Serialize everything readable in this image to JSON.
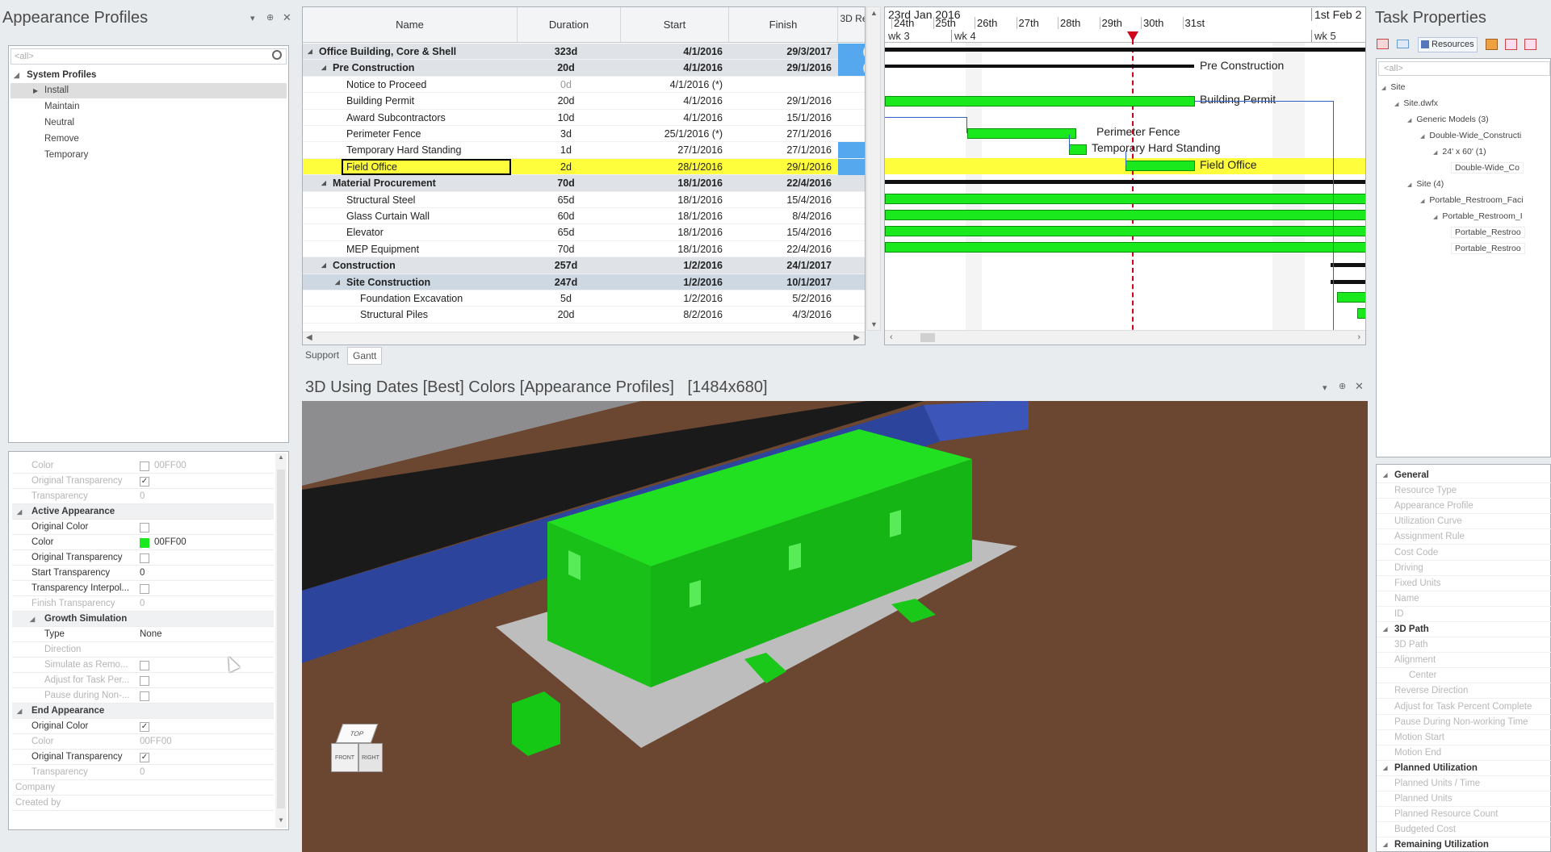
{
  "left_panel": {
    "title": "Appearance Profiles",
    "filter_placeholder": "<all>",
    "tree_root": "System Profiles",
    "tree_items": [
      "Install",
      "Maintain",
      "Neutral",
      "Remove",
      "Temporary"
    ],
    "properties": [
      {
        "label": "Color",
        "value": "00FF00",
        "dim": true,
        "check": "box"
      },
      {
        "label": "Original Transparency",
        "value": "",
        "dim": true,
        "check": "checked"
      },
      {
        "label": "Transparency",
        "value": "0",
        "dim": true
      },
      {
        "label": "Active Appearance",
        "section": true
      },
      {
        "label": "Original Color",
        "value": "",
        "check": "box"
      },
      {
        "label": "Color",
        "value": "00FF00",
        "swatch": "#19e91d"
      },
      {
        "label": "Original Transparency",
        "value": "",
        "check": "box"
      },
      {
        "label": "Start Transparency",
        "value": "0"
      },
      {
        "label": "Transparency Interpol...",
        "value": "",
        "check": "box"
      },
      {
        "label": "Finish Transparency",
        "value": "0",
        "dim": true
      },
      {
        "label": "Growth Simulation",
        "section": true,
        "sub": true
      },
      {
        "label": "Type",
        "value": "None",
        "sub": true
      },
      {
        "label": "Direction",
        "value": "",
        "dim": true,
        "sub": true
      },
      {
        "label": "Simulate as Remo...",
        "value": "",
        "dim": true,
        "sub": true,
        "check": "box"
      },
      {
        "label": "Adjust for Task Per...",
        "value": "",
        "dim": true,
        "sub": true,
        "check": "box"
      },
      {
        "label": "Pause during Non-...",
        "value": "",
        "dim": true,
        "sub": true,
        "check": "box"
      },
      {
        "label": "End Appearance",
        "section": true
      },
      {
        "label": "Original Color",
        "value": "",
        "check": "checked"
      },
      {
        "label": "Color",
        "value": "00FF00",
        "dim": true
      },
      {
        "label": "Original Transparency",
        "value": "",
        "check": "checked"
      },
      {
        "label": "Transparency",
        "value": "0",
        "dim": true
      },
      {
        "label": "Company",
        "value": "",
        "dim": true,
        "top": true
      },
      {
        "label": "Created by",
        "value": "",
        "dim": true,
        "top": true
      }
    ]
  },
  "grid": {
    "columns": [
      "Name",
      "Duration",
      "Start",
      "Finish",
      "3D Re..."
    ],
    "rows": [
      {
        "name": "Office Building, Core & Shell",
        "level": 0,
        "type": "sum",
        "duration": "323d",
        "start": "4/1/2016",
        "finish": "29/3/2017",
        "res": "(4)"
      },
      {
        "name": "Pre Construction",
        "level": 1,
        "type": "sum",
        "duration": "20d",
        "start": "4/1/2016",
        "finish": "29/1/2016",
        "res": "(4)"
      },
      {
        "name": "Notice to Proceed",
        "level": 2,
        "type": "task",
        "duration": "0d",
        "start": "4/1/2016 (*)",
        "finish": "",
        "res": ""
      },
      {
        "name": "Building Permit",
        "level": 2,
        "type": "task",
        "duration": "20d",
        "start": "4/1/2016",
        "finish": "29/1/2016",
        "res": ""
      },
      {
        "name": "Award Subcontractors",
        "level": 2,
        "type": "task",
        "duration": "10d",
        "start": "4/1/2016",
        "finish": "15/1/2016",
        "res": ""
      },
      {
        "name": "Perimeter Fence",
        "level": 2,
        "type": "task",
        "duration": "3d",
        "start": "25/1/2016 (*)",
        "finish": "27/1/2016",
        "res": ""
      },
      {
        "name": "Temporary Hard Standing",
        "level": 2,
        "type": "task",
        "duration": "1d",
        "start": "27/1/2016",
        "finish": "27/1/2016",
        "res": "1"
      },
      {
        "name": "Field Office",
        "level": 2,
        "type": "sel",
        "duration": "2d",
        "start": "28/1/2016",
        "finish": "29/1/2016",
        "res": "3"
      },
      {
        "name": "Material Procurement",
        "level": 1,
        "type": "sum",
        "duration": "70d",
        "start": "18/1/2016",
        "finish": "22/4/2016",
        "res": ""
      },
      {
        "name": "Structural Steel",
        "level": 2,
        "type": "task",
        "duration": "65d",
        "start": "18/1/2016",
        "finish": "15/4/2016",
        "res": ""
      },
      {
        "name": "Glass Curtain Wall",
        "level": 2,
        "type": "task",
        "duration": "60d",
        "start": "18/1/2016",
        "finish": "8/4/2016",
        "res": ""
      },
      {
        "name": "Elevator",
        "level": 2,
        "type": "task",
        "duration": "65d",
        "start": "18/1/2016",
        "finish": "15/4/2016",
        "res": ""
      },
      {
        "name": "MEP Equipment",
        "level": 2,
        "type": "task",
        "duration": "70d",
        "start": "18/1/2016",
        "finish": "22/4/2016",
        "res": ""
      },
      {
        "name": "Construction",
        "level": 1,
        "type": "sum",
        "duration": "257d",
        "start": "1/2/2016",
        "finish": "24/1/2017",
        "res": ""
      },
      {
        "name": "Site Construction",
        "level": 2,
        "type": "sum2",
        "duration": "247d",
        "start": "1/2/2016",
        "finish": "10/1/2017",
        "res": ""
      },
      {
        "name": "Foundation Excavation",
        "level": 3,
        "type": "task",
        "duration": "5d",
        "start": "1/2/2016",
        "finish": "5/2/2016",
        "res": ""
      },
      {
        "name": "Structural Piles",
        "level": 3,
        "type": "task",
        "duration": "20d",
        "start": "8/2/2016",
        "finish": "4/3/2016",
        "res": ""
      }
    ],
    "tabs": [
      "Support",
      "Gantt"
    ]
  },
  "gantt": {
    "date_top": [
      "23rd Jan 2016",
      "1st Feb 2"
    ],
    "days": [
      "24th",
      "25th",
      "26th",
      "27th",
      "28th",
      "29th",
      "30th",
      "31st"
    ],
    "weeks": [
      "wk 3",
      "wk 4",
      "wk 5"
    ],
    "labels": [
      "Pre Construction",
      "Building Permit",
      "Perimeter Fence",
      "Temporary Hard Standing",
      "Field Office"
    ]
  },
  "viewport": {
    "title": "3D Using Dates [Best] Colors [Appearance Profiles]   [1484x680]",
    "cube_faces": [
      "TOP",
      "FRONT",
      "RIGHT"
    ]
  },
  "right_panel": {
    "title": "Task Properties",
    "toolbar_resources": "Resources",
    "filter_placeholder": "<all>",
    "tree": [
      {
        "label": "Site",
        "indent": 0
      },
      {
        "label": "Site.dwfx",
        "indent": 1
      },
      {
        "label": "Generic Models (3)",
        "indent": 2
      },
      {
        "label": "Double-Wide_Constructi",
        "indent": 3
      },
      {
        "label": "24' x 60' (1)",
        "indent": 4
      },
      {
        "label": "Double-Wide_Co",
        "indent": 5
      },
      {
        "label": "Site (4)",
        "indent": 2
      },
      {
        "label": "Portable_Restroom_Faci",
        "indent": 3
      },
      {
        "label": "Portable_Restroom_I",
        "indent": 4
      },
      {
        "label": "Portable_Restroo",
        "indent": 5
      },
      {
        "label": "Portable_Restroo",
        "indent": 5
      }
    ],
    "props": [
      {
        "label": "General",
        "sec": true
      },
      {
        "label": "Resource Type"
      },
      {
        "label": "Appearance Profile"
      },
      {
        "label": "Utilization Curve"
      },
      {
        "label": "Assignment Rule"
      },
      {
        "label": "Cost Code"
      },
      {
        "label": "Driving"
      },
      {
        "label": "Fixed Units"
      },
      {
        "label": "Name"
      },
      {
        "label": "ID"
      },
      {
        "label": "3D Path",
        "sec": true
      },
      {
        "label": "3D Path"
      },
      {
        "label": "Alignment"
      },
      {
        "label": "Center"
      },
      {
        "label": "Reverse Direction"
      },
      {
        "label": "Adjust for Task Percent Complete"
      },
      {
        "label": "Pause During Non-working Time"
      },
      {
        "label": "Motion Start"
      },
      {
        "label": "Motion End"
      },
      {
        "label": "Planned Utilization",
        "sec": true
      },
      {
        "label": "Planned Units / Time"
      },
      {
        "label": "Planned Units"
      },
      {
        "label": "Planned Resource Count"
      },
      {
        "label": "Budgeted Cost"
      },
      {
        "label": "Remaining Utilization",
        "sec": true
      },
      {
        "label": "Remaining Units / Time"
      }
    ]
  },
  "colors": {
    "accent_green": "#19e91d",
    "selection_yellow": "#fffe3c",
    "today_line": "#d0021b",
    "ground": "#6b4630"
  }
}
